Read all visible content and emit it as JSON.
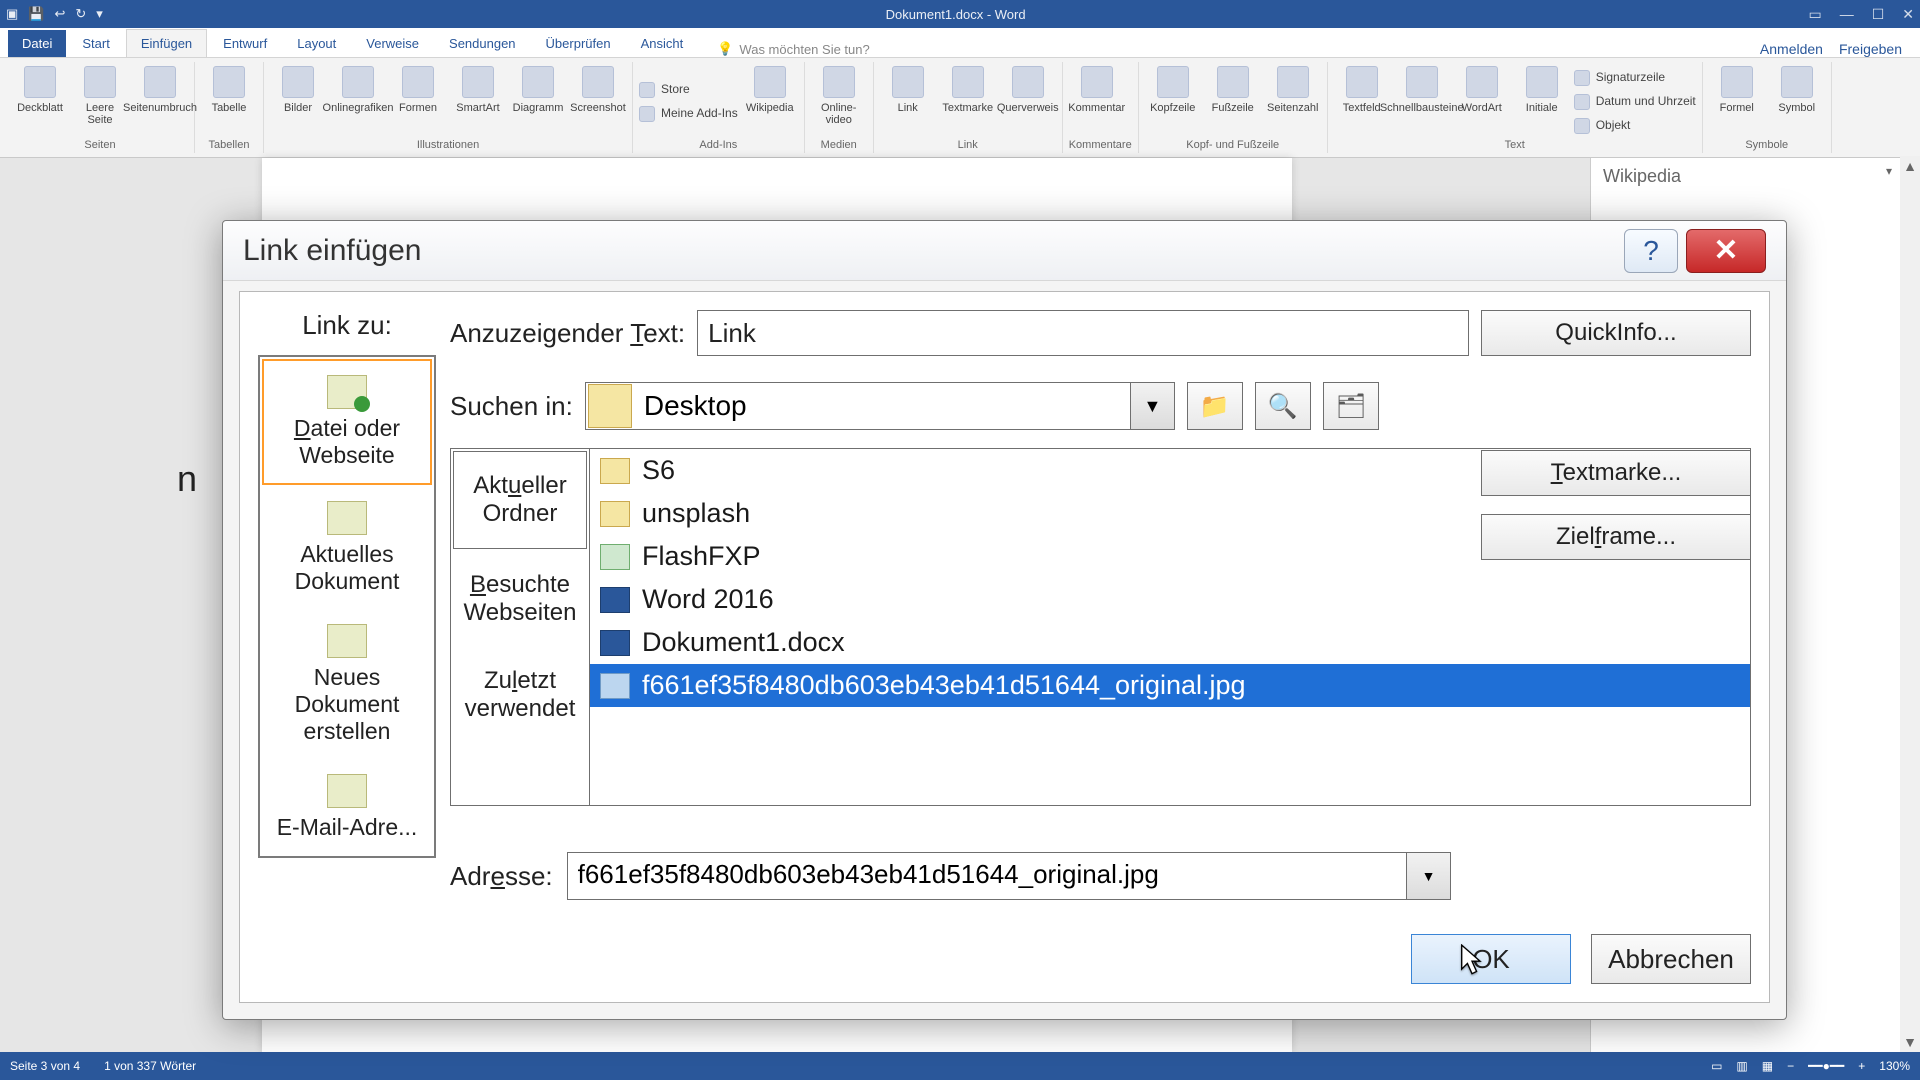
{
  "titlebar": {
    "title": "Dokument1.docx - Word"
  },
  "tabs": {
    "file": "Datei",
    "start": "Start",
    "insert": "Einfügen",
    "design": "Entwurf",
    "layout": "Layout",
    "references": "Verweise",
    "mailings": "Sendungen",
    "review": "Überprüfen",
    "view": "Ansicht",
    "tellme": "Was möchten Sie tun?",
    "signin": "Anmelden",
    "share": "Freigeben"
  },
  "ribbon": {
    "groups": {
      "seiten": "Seiten",
      "tabellen": "Tabellen",
      "illustrationen": "Illustrationen",
      "addins": "Add-Ins",
      "medien": "Medien",
      "link": "Link",
      "kommentare": "Kommentare",
      "kopf": "Kopf- und Fußzeile",
      "text": "Text",
      "symbole": "Symbole"
    },
    "btns": {
      "deckblatt": "Deckblatt",
      "leereseite": "Leere Seite",
      "seitenumbruch": "Seitenumbruch",
      "tabelle": "Tabelle",
      "bilder": "Bilder",
      "onlinegrafiken": "Onlinegrafiken",
      "formen": "Formen",
      "smartart": "SmartArt",
      "diagramm": "Diagramm",
      "screenshot": "Screenshot",
      "store": "Store",
      "meineaddins": "Meine Add-Ins",
      "wikipedia": "Wikipedia",
      "onlinevideo": "Online-video",
      "linkbtn": "Link",
      "textmarke": "Textmarke",
      "querverweis": "Querverweis",
      "kommentar": "Kommentar",
      "kopfzeile": "Kopfzeile",
      "fusszeile": "Fußzeile",
      "seitenzahl": "Seitenzahl",
      "textfeld": "Textfeld",
      "schnellbausteine": "Schnellbausteine",
      "wordart": "WordArt",
      "initiale": "Initiale",
      "signatur": "Signaturzeile",
      "datum": "Datum und Uhrzeit",
      "objekt": "Objekt",
      "formel": "Formel",
      "symbol": "Symbol"
    }
  },
  "wikipane": {
    "title": "Wikipedia"
  },
  "statusbar": {
    "page": "Seite 3 von 4",
    "words": "1 von 337 Wörter",
    "zoom": "130%"
  },
  "peek_char": "n",
  "dialog": {
    "title": "Link einfügen",
    "linkzu_label": "Link zu:",
    "linkzu_options": {
      "file": "Datei oder Webseite",
      "doc": "Aktuelles Dokument",
      "new": "Neues Dokument erstellen",
      "email": "E-Mail-Adre..."
    },
    "display_label": "Anzuzeigender Text:",
    "display_value": "Link",
    "quickinfo": "QuickInfo...",
    "search_label": "Suchen in:",
    "search_value": "Desktop",
    "subtabs": {
      "current": "Aktueller Ordner",
      "browsed": "Besuchte Webseiten",
      "recent": "Zuletzt verwendet"
    },
    "files": [
      {
        "name": "S6",
        "kind": "folder"
      },
      {
        "name": "unsplash",
        "kind": "folder"
      },
      {
        "name": "FlashFXP",
        "kind": "exe"
      },
      {
        "name": "Word 2016",
        "kind": "word"
      },
      {
        "name": "Dokument1.docx",
        "kind": "word"
      },
      {
        "name": "f661ef35f8480db603eb43eb41d51644_original.jpg",
        "kind": "img",
        "selected": true
      }
    ],
    "textmarke": "Textmarke...",
    "zielframe": "Zielframe...",
    "address_label": "Adresse:",
    "address_value": "f661ef35f8480db603eb43eb41d51644_original.jpg",
    "ok": "OK",
    "cancel": "Abbrechen"
  }
}
